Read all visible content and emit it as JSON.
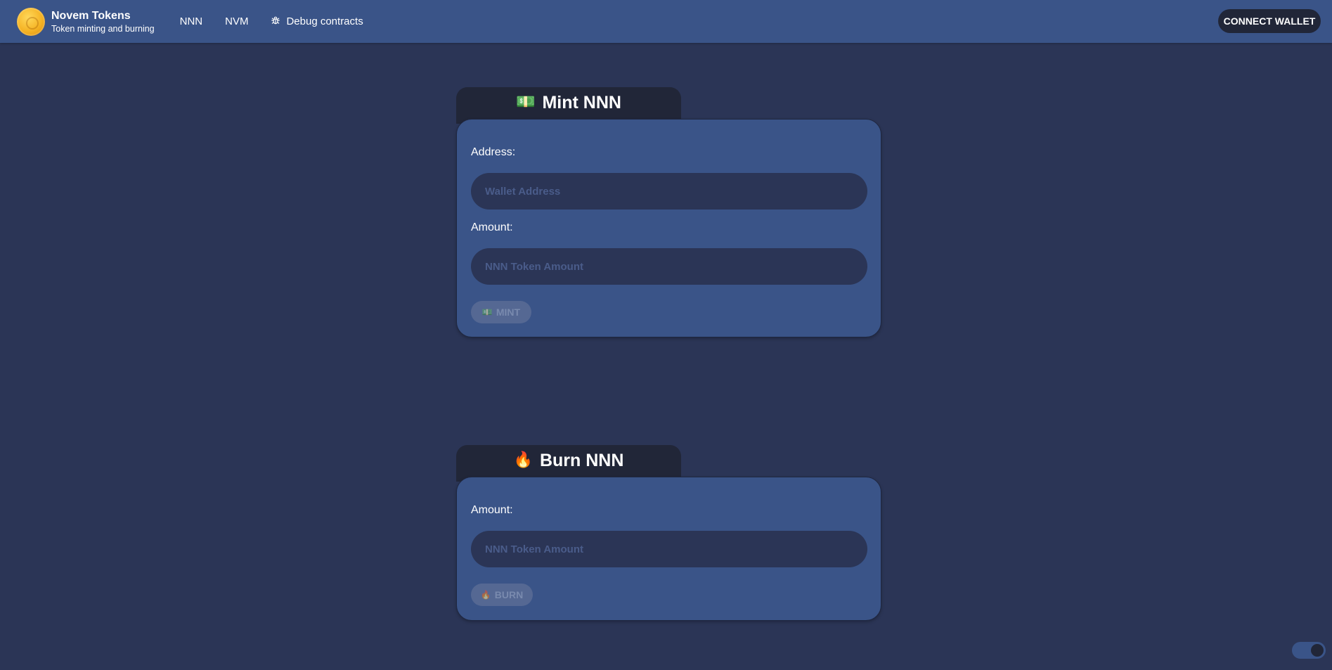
{
  "brand": {
    "title": "Novem Tokens",
    "subtitle": "Token minting and burning"
  },
  "nav": {
    "links": [
      "NNN",
      "NVM",
      "Debug contracts"
    ],
    "connect_label": "CONNECT WALLET"
  },
  "mint": {
    "emoji": "💵",
    "title": "Mint NNN",
    "address_label": "Address:",
    "address_placeholder": "Wallet Address",
    "amount_label": "Amount:",
    "amount_placeholder": "NNN Token Amount",
    "button_emoji": "💵",
    "button_label": "MINT"
  },
  "burn": {
    "emoji": "🔥",
    "title": "Burn NNN",
    "amount_label": "Amount:",
    "amount_placeholder": "NNN Token Amount",
    "button_emoji": "🔥",
    "button_label": "BURN"
  },
  "colors": {
    "background": "#2b3556",
    "navbar": "#3a5488",
    "card": "#3a5488",
    "tab": "#212638"
  },
  "icons": {
    "logo": "coin-logo",
    "debug": "bug-icon",
    "theme": "theme-toggle"
  }
}
